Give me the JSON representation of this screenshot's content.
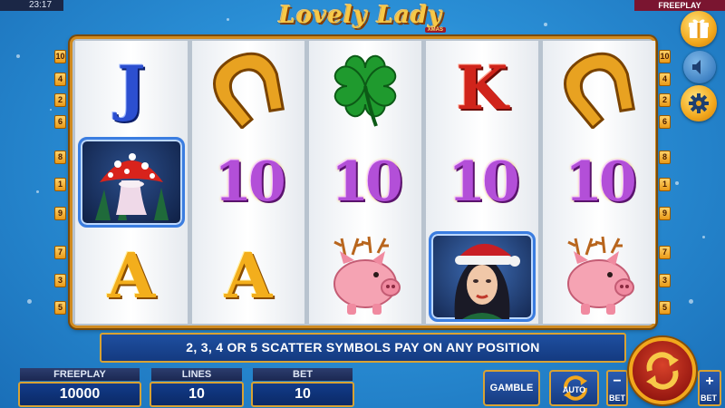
{
  "status_bar": {
    "time": "23:17",
    "mode": "FREEPLAY"
  },
  "logo": {
    "title": "Lovely Lady",
    "subtitle": "XMAS"
  },
  "paylines": {
    "left": [
      "10",
      "4",
      "2",
      "6",
      "8",
      "1",
      "9",
      "7",
      "3",
      "5"
    ],
    "right": [
      "10",
      "4",
      "2",
      "6",
      "8",
      "1",
      "9",
      "7",
      "3",
      "5"
    ]
  },
  "reels": [
    [
      "J",
      "mushroom",
      "A"
    ],
    [
      "horseshoe",
      "10",
      "A"
    ],
    [
      "clover",
      "10",
      "piggy-bank"
    ],
    [
      "K",
      "10",
      "lady"
    ],
    [
      "horseshoe",
      "10",
      "piggy-bank"
    ]
  ],
  "symbol_labels": {
    "j": "J",
    "k": "K",
    "a": "A",
    "ten": "10"
  },
  "info_message": "2, 3, 4 OR 5 SCATTER SYMBOLS PAY ON ANY POSITION",
  "panel": {
    "balance_label": "FREEPLAY",
    "balance_value": "10000",
    "lines_label": "LINES",
    "lines_value": "10",
    "bet_label": "BET",
    "bet_value": "10"
  },
  "buttons": {
    "gamble": "GAMBLE",
    "auto": "AUTO",
    "bet_minus_sign": "−",
    "bet_minus_text": "BET",
    "bet_plus_sign": "+",
    "bet_plus_text": "BET"
  },
  "side_buttons": [
    "gift-icon",
    "speaker-mute-icon",
    "gear-icon"
  ],
  "colors": {
    "frame_gold": "#d08a1f",
    "banner_blue": "#1e4fa0",
    "spin_red": "#b0221a",
    "background_blue": "#2a8fd6"
  }
}
